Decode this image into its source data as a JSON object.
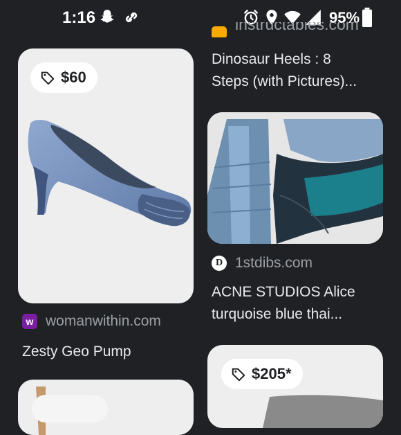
{
  "status_bar": {
    "time": "1:16",
    "battery": "95%",
    "icons": [
      "snapchat-icon",
      "link-icon",
      "alarm-icon",
      "location-icon",
      "wifi-icon",
      "signal-icon",
      "battery-icon"
    ]
  },
  "results": [
    {
      "price": "$60",
      "source": "womanwithin.com",
      "favicon_letter": "w",
      "favicon_color": "#7b1fa2",
      "title": "Zesty Geo Pump"
    },
    {
      "source": "instructables.com",
      "title_line1": "Dinosaur Heels : 8",
      "title_line2": "Steps (with Pictures)..."
    },
    {
      "source": "1stdibs.com",
      "favicon_letter": "D",
      "title_line1": "ACNE STUDIOS Alice",
      "title_line2": "turquoise blue thai..."
    },
    {
      "price": "$205*"
    }
  ]
}
